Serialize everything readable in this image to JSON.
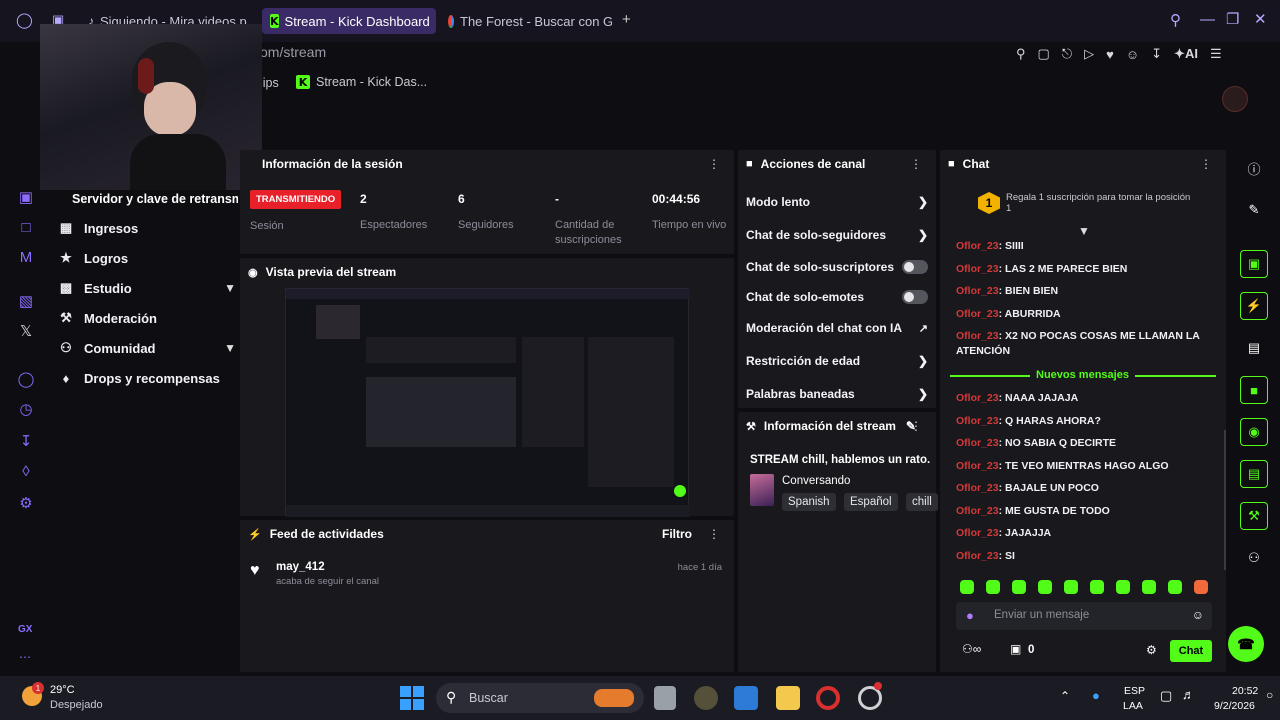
{
  "tabs": [
    {
      "label": "Siguiendo - Mira videos p",
      "icon": "tiktok-icon"
    },
    {
      "label": "Stream - Kick Dashboard",
      "icon": "kick-icon"
    },
    {
      "label": "The Forest - Buscar con G",
      "icon": "google-icon"
    }
  ],
  "url": "om/stream",
  "bookmarks": [
    "lips",
    "Stream - Kick Das..."
  ],
  "toolbar_ai_label": "AI",
  "sidebar": {
    "header": "Servidor y clave de retransm",
    "items": [
      {
        "label": "Ingresos",
        "icon": "revenue-icon"
      },
      {
        "label": "Logros",
        "icon": "trophy-icon"
      },
      {
        "label": "Estudio",
        "icon": "studio-icon"
      },
      {
        "label": "Moderación",
        "icon": "wrench-icon"
      },
      {
        "label": "Comunidad",
        "icon": "community-icon"
      },
      {
        "label": "Drops y recompensas",
        "icon": "drops-icon"
      }
    ],
    "gx_label": "GX"
  },
  "session": {
    "title": "Información de la sesión",
    "status_badge": "TRANSMITIENDO",
    "status_caption": "Sesión",
    "stats": [
      {
        "value": "2",
        "label": "Espectadores"
      },
      {
        "value": "6",
        "label": "Seguidores"
      },
      {
        "value": "-",
        "label": "Cantidad de suscripciones"
      },
      {
        "value": "00:44:56",
        "label": "Tiempo en vivo"
      }
    ]
  },
  "preview": {
    "title": "Vista previa del stream"
  },
  "feed": {
    "title": "Feed de actividades",
    "filter_label": "Filtro",
    "items": [
      {
        "user": "may_412",
        "action": "acaba de seguir el canal",
        "time": "hace 1 día"
      }
    ]
  },
  "actions": {
    "title": "Acciones de canal",
    "rows": [
      {
        "label": "Modo lento",
        "kind": "chevron"
      },
      {
        "label": "Chat de solo-seguidores",
        "kind": "chevron"
      },
      {
        "label": "Chat de solo-suscriptores",
        "kind": "toggle"
      },
      {
        "label": "Chat de solo-emotes",
        "kind": "toggle"
      },
      {
        "label": "Moderación del chat con IA",
        "kind": "external"
      },
      {
        "label": "Restricción de edad",
        "kind": "chevron"
      },
      {
        "label": "Palabras baneadas",
        "kind": "chevron"
      }
    ]
  },
  "stream_info": {
    "title": "Información del stream",
    "stream_title": "STREAM chill, hablemos un rato...",
    "category": "Conversando",
    "tags": [
      "Spanish",
      "Español",
      "chill"
    ]
  },
  "chat": {
    "title": "Chat",
    "gift_prompt": "Regala 1 suscripción para tomar la posición 1",
    "messages_before": [
      {
        "user": "Oflor_23",
        "text": ": SIIII"
      },
      {
        "user": "Oflor_23",
        "text": ": LAS 2 ME PARECE BIEN"
      },
      {
        "user": "Oflor_23",
        "text": ": BIEN BIEN"
      },
      {
        "user": "Oflor_23",
        "text": ": ABURRIDA"
      },
      {
        "user": "Oflor_23",
        "text": ": X2 NO POCAS COSAS ME LLAMAN LA ATENCIÓN"
      }
    ],
    "new_messages_label": "Nuevos mensajes",
    "messages_after": [
      {
        "user": "Oflor_23",
        "text": ": NAAA JAJAJA"
      },
      {
        "user": "Oflor_23",
        "text": ": Q HARAS AHORA?"
      },
      {
        "user": "Oflor_23",
        "text": ": NO SABIA Q DECIRTE"
      },
      {
        "user": "Oflor_23",
        "text": ": TE VEO MIENTRAS HAGO ALGO"
      },
      {
        "user": "Oflor_23",
        "text": ": BAJALE UN POCO"
      },
      {
        "user": "Oflor_23",
        "text": ": ME GUSTA DE TODO"
      },
      {
        "user": "Oflor_23",
        "text": ": JAJAJJA"
      },
      {
        "user": "Oflor_23",
        "text": ": SI"
      }
    ],
    "input_placeholder": "Enviar un mensaje",
    "points_count": "0",
    "send_label": "Chat"
  },
  "taskbar": {
    "weather_temp": "29°C",
    "weather_desc": "Despejado",
    "weather_badge": "1",
    "search_placeholder": "Buscar",
    "lang_top": "ESP",
    "lang_bottom": "LAA",
    "time": "20:52",
    "date": "9/2/2026"
  },
  "colors": {
    "kick_green": "#53fc18",
    "live_red": "#e8202a",
    "username_red": "#d43939",
    "opera_purple": "#8c6cff"
  }
}
